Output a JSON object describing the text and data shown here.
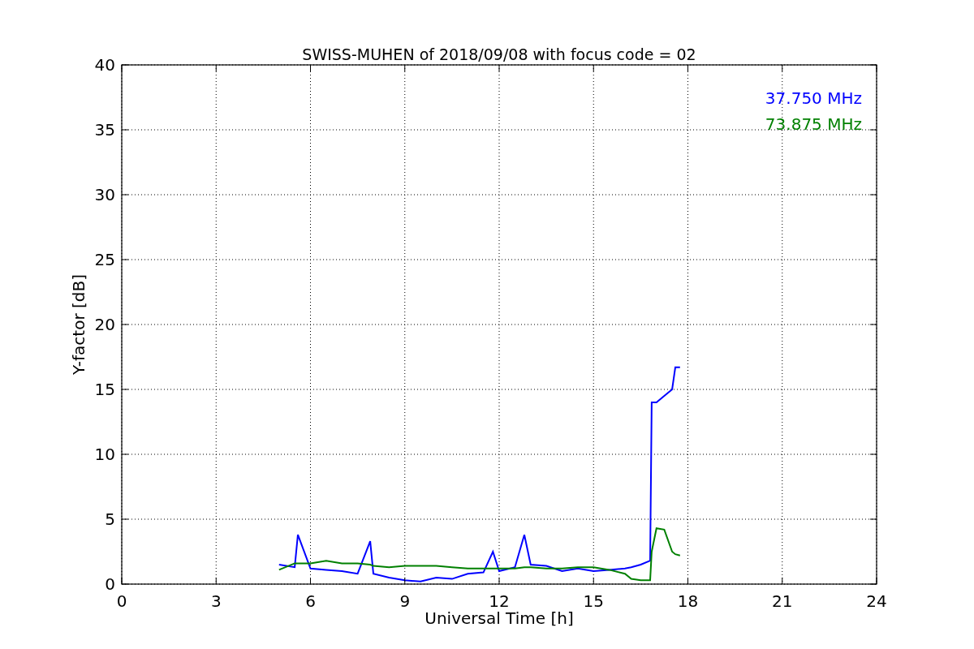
{
  "plot": {
    "chart_data": {
      "type": "line",
      "title": "SWISS-MUHEN of 2018/09/08 with focus code = 02",
      "xlabel": "Universal Time [h]",
      "ylabel": "Y-factor [dB]",
      "x": [
        5,
        5.5,
        5.6,
        6,
        6.5,
        7,
        7.5,
        7.9,
        8,
        8.5,
        9,
        9.5,
        10,
        10.5,
        11,
        11.5,
        11.8,
        12,
        12.5,
        12.8,
        13,
        13.5,
        14,
        14.5,
        15,
        15.5,
        16,
        16.2,
        16.5,
        16.8,
        16.85,
        17,
        17.25,
        17.5,
        17.6,
        17.75
      ],
      "series": [
        {
          "name": "37.750 MHz",
          "color": "#0000ff",
          "values": [
            1.5,
            1.3,
            3.8,
            1.2,
            1.1,
            1.0,
            0.8,
            3.3,
            0.8,
            0.5,
            0.3,
            0.2,
            0.5,
            0.4,
            0.8,
            0.9,
            2.5,
            1.0,
            1.3,
            3.8,
            1.5,
            1.4,
            1.0,
            1.2,
            1.0,
            1.1,
            1.2,
            1.3,
            1.5,
            1.8,
            14,
            14,
            14.5,
            15,
            16.7,
            16.7
          ]
        },
        {
          "name": "73.875 MHz",
          "color": "#008000",
          "values": [
            1.1,
            1.6,
            1.6,
            1.6,
            1.8,
            1.6,
            1.6,
            1.5,
            1.4,
            1.3,
            1.4,
            1.4,
            1.4,
            1.3,
            1.2,
            1.2,
            1.2,
            1.2,
            1.2,
            1.3,
            1.3,
            1.2,
            1.2,
            1.3,
            1.3,
            1.1,
            0.8,
            0.4,
            0.3,
            0.3,
            2.5,
            4.3,
            4.2,
            2.5,
            2.3,
            2.2
          ]
        }
      ],
      "xlim": [
        0,
        24
      ],
      "ylim": [
        0,
        40
      ],
      "xticks": [
        0,
        3,
        6,
        9,
        12,
        15,
        18,
        21,
        24
      ],
      "yticks": [
        0,
        5,
        10,
        15,
        20,
        25,
        30,
        35,
        40
      ],
      "grid": true
    }
  }
}
